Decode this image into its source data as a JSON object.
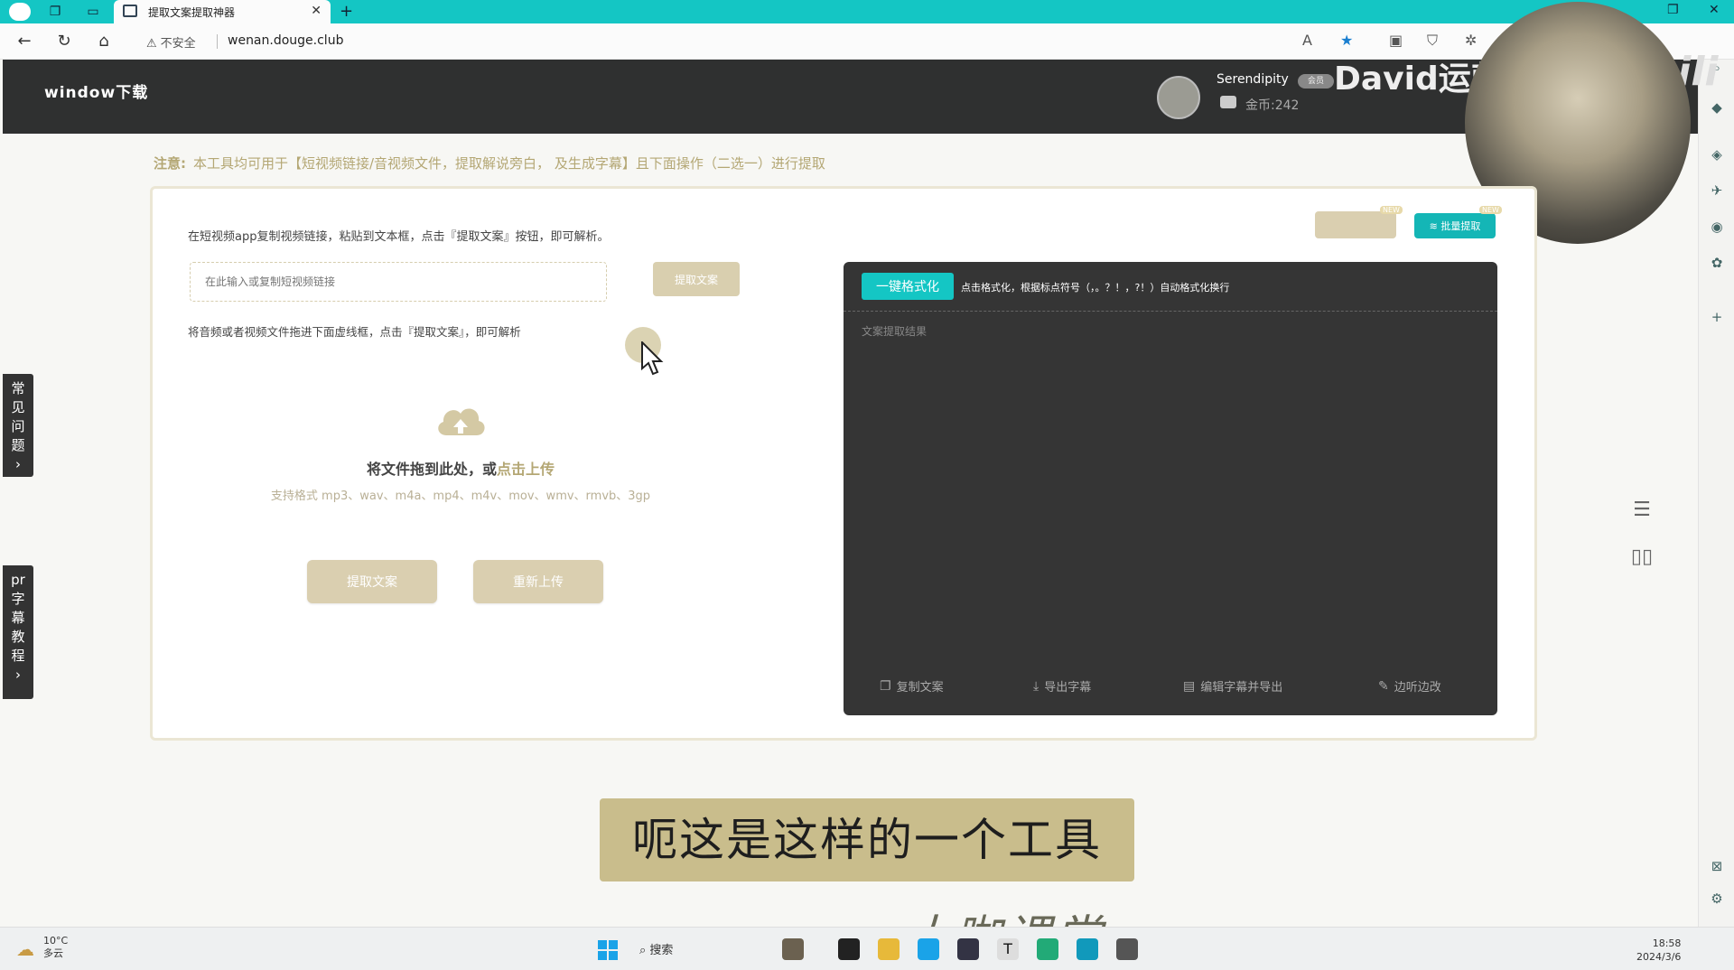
{
  "browser": {
    "tab_title": "提取文案提取神器",
    "security_label": "不安全",
    "url": "wenan.dougе.club"
  },
  "site": {
    "logo": "window下载",
    "user": {
      "name": "Serendipity",
      "badge": "会员",
      "coins": "金币:242"
    },
    "video_overlay_title": "David运营课堂",
    "video_overlay_brand": "bilibili"
  },
  "notice": {
    "lead": "注意:",
    "text": "本工具均可用于【短视频链接/音视频文件，提取解说旁白， 及生成字幕】且下面操作（二选一）进行提取"
  },
  "link_section": {
    "hint": "在短视频app复制视频链接，粘贴到文本框，点击『提取文案』按钮，即可解析。",
    "input_placeholder": "在此输入或复制短视频链接",
    "extract_button": "提取文案"
  },
  "upload_section": {
    "hint": "将音频或者视频文件拖进下面虚线框，点击『提取文案』，即可解析",
    "drop_text": "将文件拖到此处，或",
    "drop_link": "点击上传",
    "formats": "支持格式 mp3、wav、m4a、mp4、m4v、mov、wmv、rmvb、3gp",
    "extract_button": "提取文案",
    "reupload_button": "重新上传"
  },
  "top_buttons": {
    "left_button": "",
    "batch_button": "批量提取",
    "new_tag": "NEW"
  },
  "result": {
    "format_button": "一键格式化",
    "format_desc": "点击格式化，根据标点符号（，。？！，?！）自动格式化换行",
    "placeholder": "文案提取结果",
    "actions": [
      {
        "icon": "copy-icon",
        "label": "复制文案"
      },
      {
        "icon": "download-icon",
        "label": "导出字幕"
      },
      {
        "icon": "edit-icon",
        "label": "编辑字幕并导出"
      },
      {
        "icon": "pencil-icon",
        "label": "边听边改"
      }
    ]
  },
  "side_tabs": {
    "faq": "常见问题",
    "pr_tutorial": "pr字幕教程"
  },
  "subtitle": "呃这是这样的一个工具",
  "watermark": "大咖课堂",
  "taskbar": {
    "temperature": "10°C",
    "weather": "多云",
    "search": "搜索",
    "time": "18:58",
    "date": "2024/3/6"
  },
  "colors": {
    "teal": "#14c6c4",
    "tan": "#dacfb0",
    "header_dark": "#2f3030",
    "result_dark": "#353535"
  }
}
